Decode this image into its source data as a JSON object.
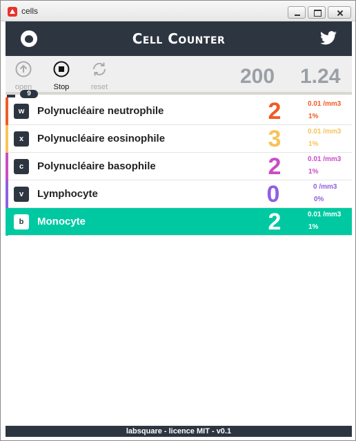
{
  "window": {
    "title": "cells"
  },
  "header": {
    "title": "Cell Counter",
    "left_icon": "github-icon",
    "right_icon": "twitter-icon"
  },
  "toolbar": {
    "open_label": "open",
    "stop_label": "Stop",
    "reset_label": "reset",
    "total": "200",
    "ratio": "1.24"
  },
  "progress": {
    "badge": "9"
  },
  "cells": [
    {
      "key": "w",
      "name": "Polynucléaire neutrophile",
      "count": "2",
      "conc": "0.01 /mm3",
      "pct": "1%",
      "color": "#f15a24"
    },
    {
      "key": "x",
      "name": "Polynucléaire eosinophile",
      "count": "3",
      "conc": "0.01 /mm3",
      "pct": "1%",
      "color": "#f7c35a"
    },
    {
      "key": "c",
      "name": "Polynucléaire basophile",
      "count": "2",
      "conc": "0.01 /mm3",
      "pct": "1%",
      "color": "#c94cc6"
    },
    {
      "key": "v",
      "name": "Lymphocyte",
      "count": "0",
      "conc": "0 /mm3",
      "pct": "0%",
      "color": "#8f5fe0"
    },
    {
      "key": "b",
      "name": "Monocyte",
      "count": "2",
      "conc": "0.01 /mm3",
      "pct": "1%",
      "color": "#00c9a2"
    }
  ],
  "footer": {
    "text": "labsquare - licence MIT - v0.1"
  }
}
